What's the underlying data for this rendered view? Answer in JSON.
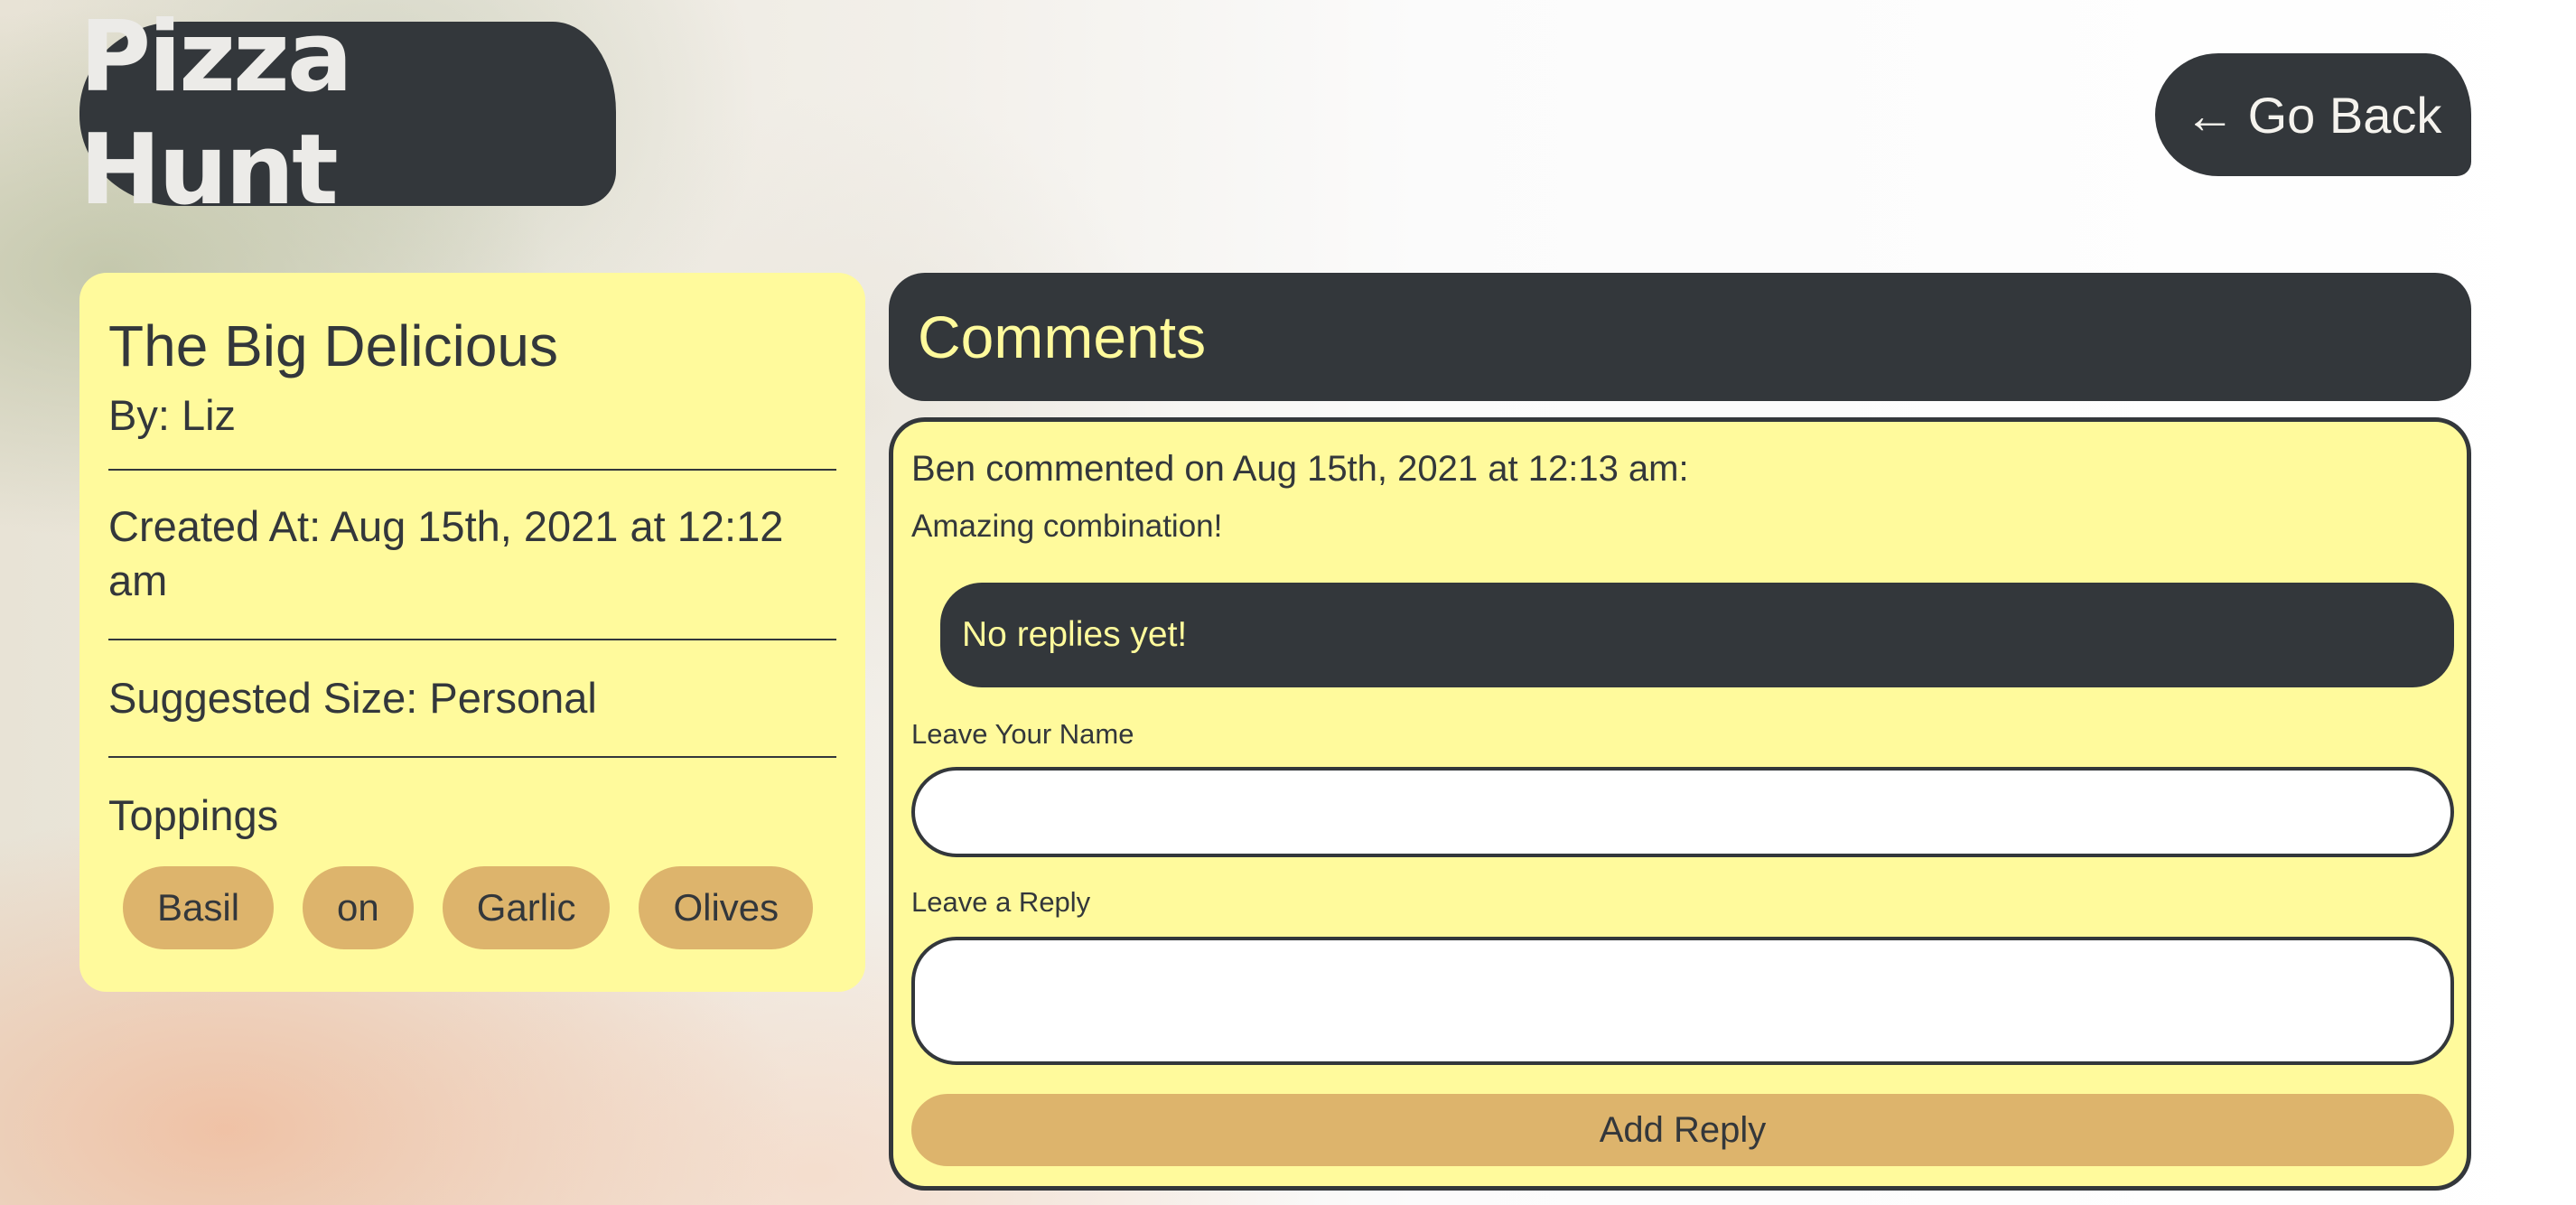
{
  "header": {
    "logo_text": "Pizza Hunt",
    "back_arrow": "←",
    "back_label": "Go Back"
  },
  "pizza": {
    "name": "The Big Delicious",
    "by_label": "By: Liz",
    "created_label": "Created At: Aug 15th, 2021 at 12:12 am",
    "size_label": "Suggested Size: Personal",
    "toppings_heading": "Toppings",
    "toppings": [
      "Basil",
      "on",
      "Garlic",
      "Olives"
    ]
  },
  "comments": {
    "heading": "Comments",
    "items": [
      {
        "meta": "Ben commented on Aug 15th, 2021 at 12:13 am:",
        "body": "Amazing combination!",
        "replies_text": "No replies yet!"
      }
    ],
    "form": {
      "name_label": "Leave Your Name",
      "reply_label": "Leave a Reply",
      "submit_label": "Add Reply"
    }
  },
  "colors": {
    "dark": "#33373b",
    "card_yellow": "#fffa9c",
    "pill_tan": "#ddb46c"
  }
}
